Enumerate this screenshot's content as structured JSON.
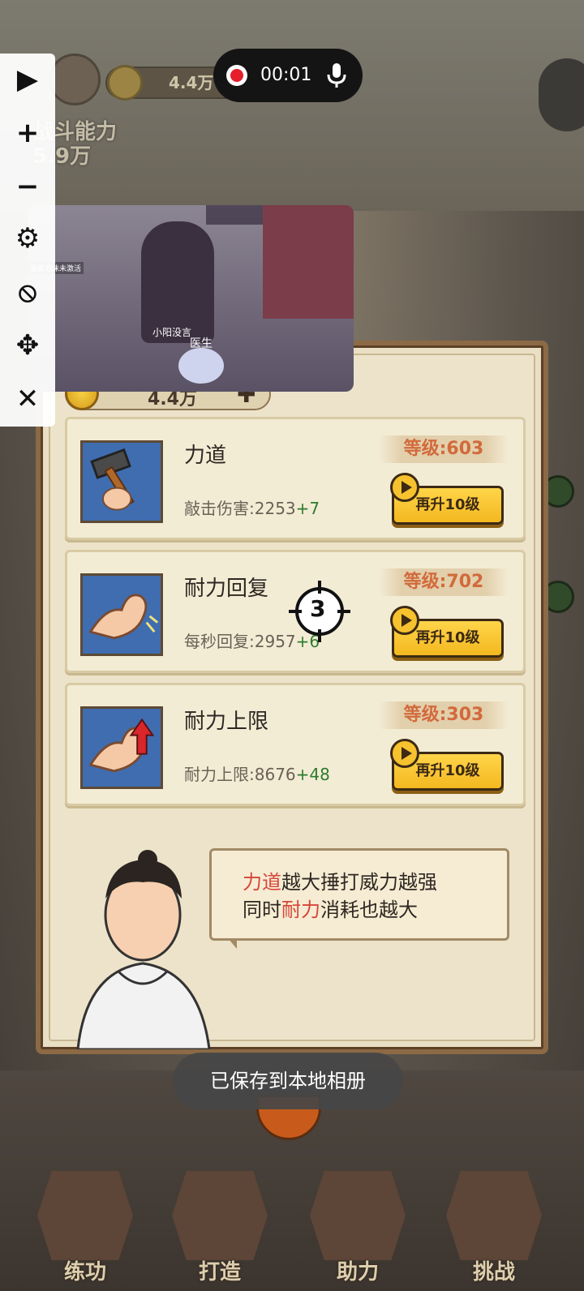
{
  "status": {
    "recording_time": "00:01"
  },
  "background": {
    "coins": "4.4万",
    "power_label": "战斗能力",
    "power_value": "5.9万"
  },
  "panel": {
    "coins": "4.4万",
    "upgrades": [
      {
        "name": "力道",
        "level": "等级:603",
        "desc_label": "敲击伤害:",
        "desc_value": "2253",
        "desc_inc": "+7",
        "button": "再升10级",
        "icon": "hammer-icon"
      },
      {
        "name": "耐力回复",
        "level": "等级:702",
        "desc_label": "每秒回复:",
        "desc_value": "2957",
        "desc_inc": "+6",
        "button": "再升10级",
        "icon": "flex-arm-icon"
      },
      {
        "name": "耐力上限",
        "level": "等级:303",
        "desc_label": "耐力上限:",
        "desc_value": "8676",
        "desc_inc": "+48",
        "button": "再升10级",
        "icon": "arm-up-arrow-icon"
      }
    ],
    "tip": {
      "line1_hl": "力道",
      "line1_rest": "越大捶打威力越强",
      "line2_pre": "同时",
      "line2_hl": "耐力",
      "line2_rest": "消耗也越大"
    }
  },
  "floating_video": {
    "name_label": "小阳没言",
    "role_label": "医生",
    "tag": "画面泡沫未激活"
  },
  "target_number": "3",
  "toast": "已保存到本地相册",
  "nav": [
    {
      "label": "练功"
    },
    {
      "label": "打造"
    },
    {
      "label": "助力"
    },
    {
      "label": "挑战"
    }
  ],
  "colors": {
    "accent_yellow": "#f3b820",
    "level_text": "#d26a3c",
    "increment_green": "#2e7b2e",
    "highlight_red": "#d6463a",
    "record_red": "#e61d2b"
  }
}
